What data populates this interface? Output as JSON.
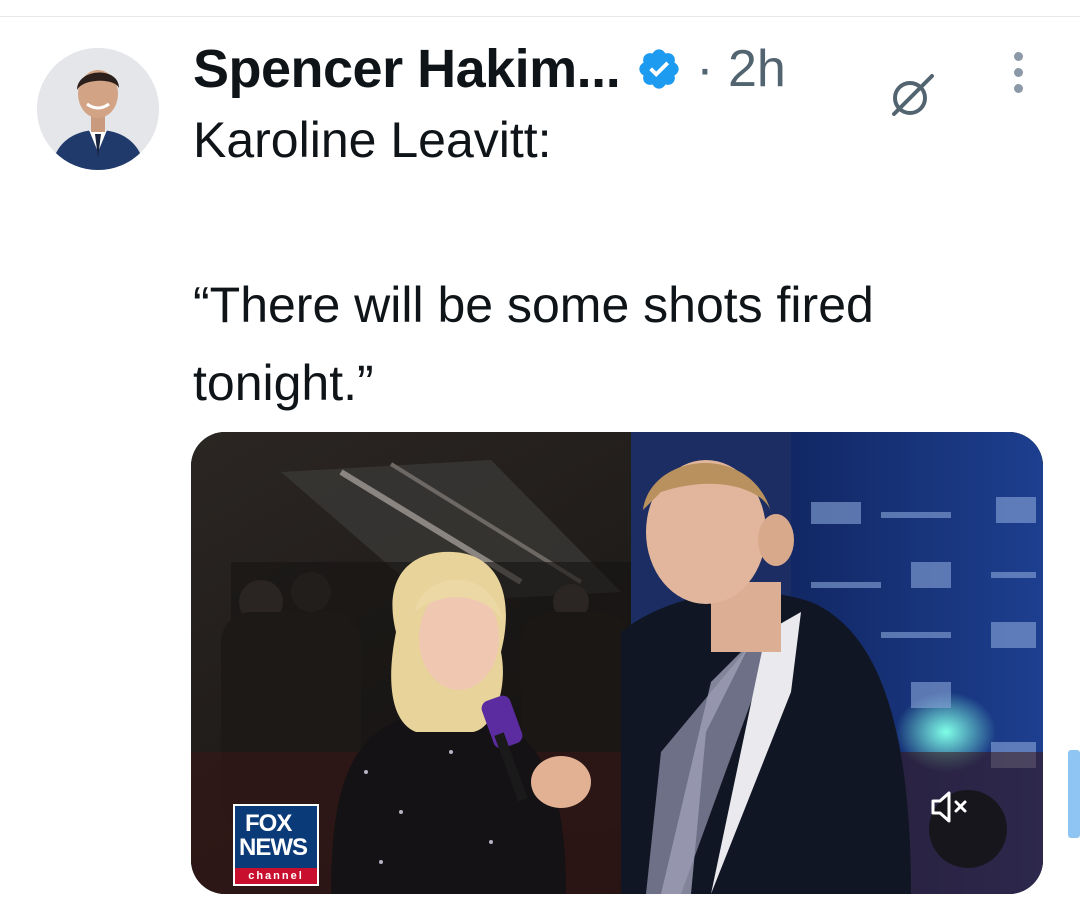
{
  "tweet": {
    "author_name": "Spencer Hakim...",
    "time_separator": "·",
    "time_ago": "2h",
    "text_line1": "Karoline Leavitt:",
    "text_quote": "“There will be some shots fired tonight.”"
  },
  "media": {
    "logo_fox": "FOX",
    "logo_news": "NEWS",
    "logo_channel": "channel"
  },
  "icons": {
    "verified": "verified-badge-icon",
    "grok": "grok-icon",
    "more": "more-options-icon",
    "mute": "speaker-muted-icon"
  },
  "colors": {
    "verified_blue": "#1d9bf0",
    "secondary_text": "#536471",
    "fox_blue": "#0b3a78",
    "fox_red": "#c8102e"
  }
}
